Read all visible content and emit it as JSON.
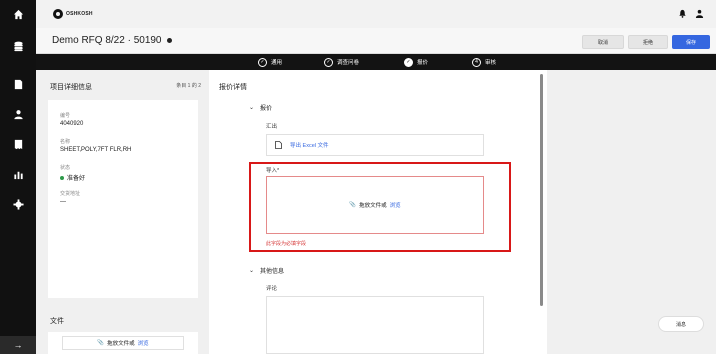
{
  "brand": {
    "name": "OSHKOSH"
  },
  "header": {
    "title": "Demo RFQ 8/22 · 50190",
    "cancel_label": "取消",
    "reject_label": "拒绝",
    "save_label": "保存"
  },
  "steps": [
    {
      "label": "通用",
      "marker": "✓"
    },
    {
      "label": "调查问卷",
      "marker": "✓"
    },
    {
      "label": "报价",
      "marker": "●"
    },
    {
      "label": "审核",
      "marker": "4"
    }
  ],
  "left_panel": {
    "heading": "项目详细信息",
    "count": "条目 1 的 2",
    "fields": [
      {
        "key": "编号",
        "value": "4040920"
      },
      {
        "key": "名称",
        "value": "SHEET,POLY,7FT FLR,RH"
      },
      {
        "key": "状态",
        "value": "准备好"
      },
      {
        "key": "交货地址",
        "value": "—"
      }
    ],
    "files_heading": "文件",
    "drop_text": "拖放文件或",
    "browse_label": "浏览"
  },
  "main": {
    "title": "报价详情",
    "quote_section": "报价",
    "export_label": "汇出",
    "export_link": "导出 Excel 文件",
    "import_label": "导入*",
    "drop_text": "拖放文件或",
    "browse_label": "浏览",
    "required_error": "此字段为必填字段",
    "other_section": "其他信息",
    "comment_label": "评论"
  },
  "right_panel": {
    "message_label": "消息"
  },
  "icons": [
    "home-icon",
    "database-icon",
    "document-icon",
    "users-icon",
    "receipt-icon",
    "chart-icon",
    "gear-icon",
    "arrow-right-icon",
    "bell-icon",
    "user-icon",
    "paperclip-icon",
    "file-icon",
    "chevron-down-icon"
  ],
  "colors": {
    "accent": "#3567e0",
    "error": "#d63a3a",
    "highlight": "#d81818",
    "status_ready": "#2e9a4a"
  }
}
